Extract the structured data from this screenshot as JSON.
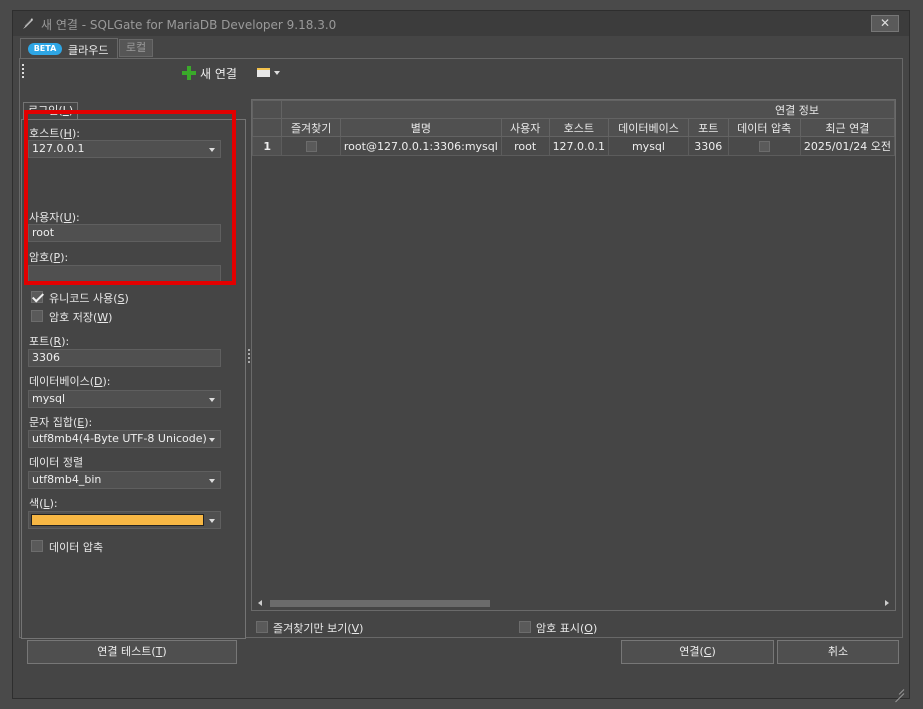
{
  "window": {
    "title": "새 연결 - SQLGate for MariaDB Developer 9.18.3.0",
    "close_label": "✕"
  },
  "tabs": [
    {
      "badge": "BETA",
      "label": "클라우드"
    },
    {
      "label": "로컬"
    }
  ],
  "toolbar": {
    "new_connection_label": "새 연결"
  },
  "login": {
    "tab_label": "로그인",
    "tab_shortcut": "L",
    "host_label": "호스트",
    "host_shortcut": "H",
    "host_value": "127.0.0.1",
    "user_label": "사용자",
    "user_shortcut": "U",
    "user_value": "root",
    "password_label": "암호",
    "password_shortcut": "P",
    "password_value": "",
    "unicode_label": "유니코드 사용",
    "unicode_shortcut": "S",
    "unicode_checked": true,
    "save_password_label": "암호 저장",
    "save_password_shortcut": "W",
    "save_password_checked": false,
    "port_label": "포트",
    "port_shortcut": "R",
    "port_value": "3306",
    "database_label": "데이터베이스",
    "database_shortcut": "D",
    "database_value": "mysql",
    "charset_label": "문자 집합",
    "charset_shortcut": "E",
    "charset_value": "utf8mb4(4-Byte UTF-8 Unicode)",
    "collation_label": "데이터 정렬",
    "collation_value": "utf8mb4_bin",
    "color_label": "색",
    "color_shortcut": "L",
    "color_value": "#f7b744",
    "compress_label": "데이터 압축",
    "compress_checked": false
  },
  "grid": {
    "group_header": "연결 정보",
    "columns": [
      "즐겨찾기",
      "별명",
      "사용자",
      "호스트",
      "데이터베이스",
      "포트",
      "데이터 압축",
      "최근 연결"
    ],
    "rows": [
      {
        "num": "1",
        "favorite": false,
        "alias": "root@127.0.0.1:3306:mysql",
        "user": "root",
        "host": "127.0.0.1",
        "database": "mysql",
        "port": "3306",
        "compress": false,
        "last": "2025/01/24 오전"
      }
    ]
  },
  "options": {
    "favorites_only_label": "즐겨찾기만 보기",
    "favorites_only_shortcut": "V",
    "show_password_label": "암호 표시",
    "show_password_shortcut": "O"
  },
  "buttons": {
    "test_label": "연결 테스트",
    "test_shortcut": "T",
    "connect_label": "연결",
    "connect_shortcut": "C",
    "cancel_label": "취소"
  }
}
